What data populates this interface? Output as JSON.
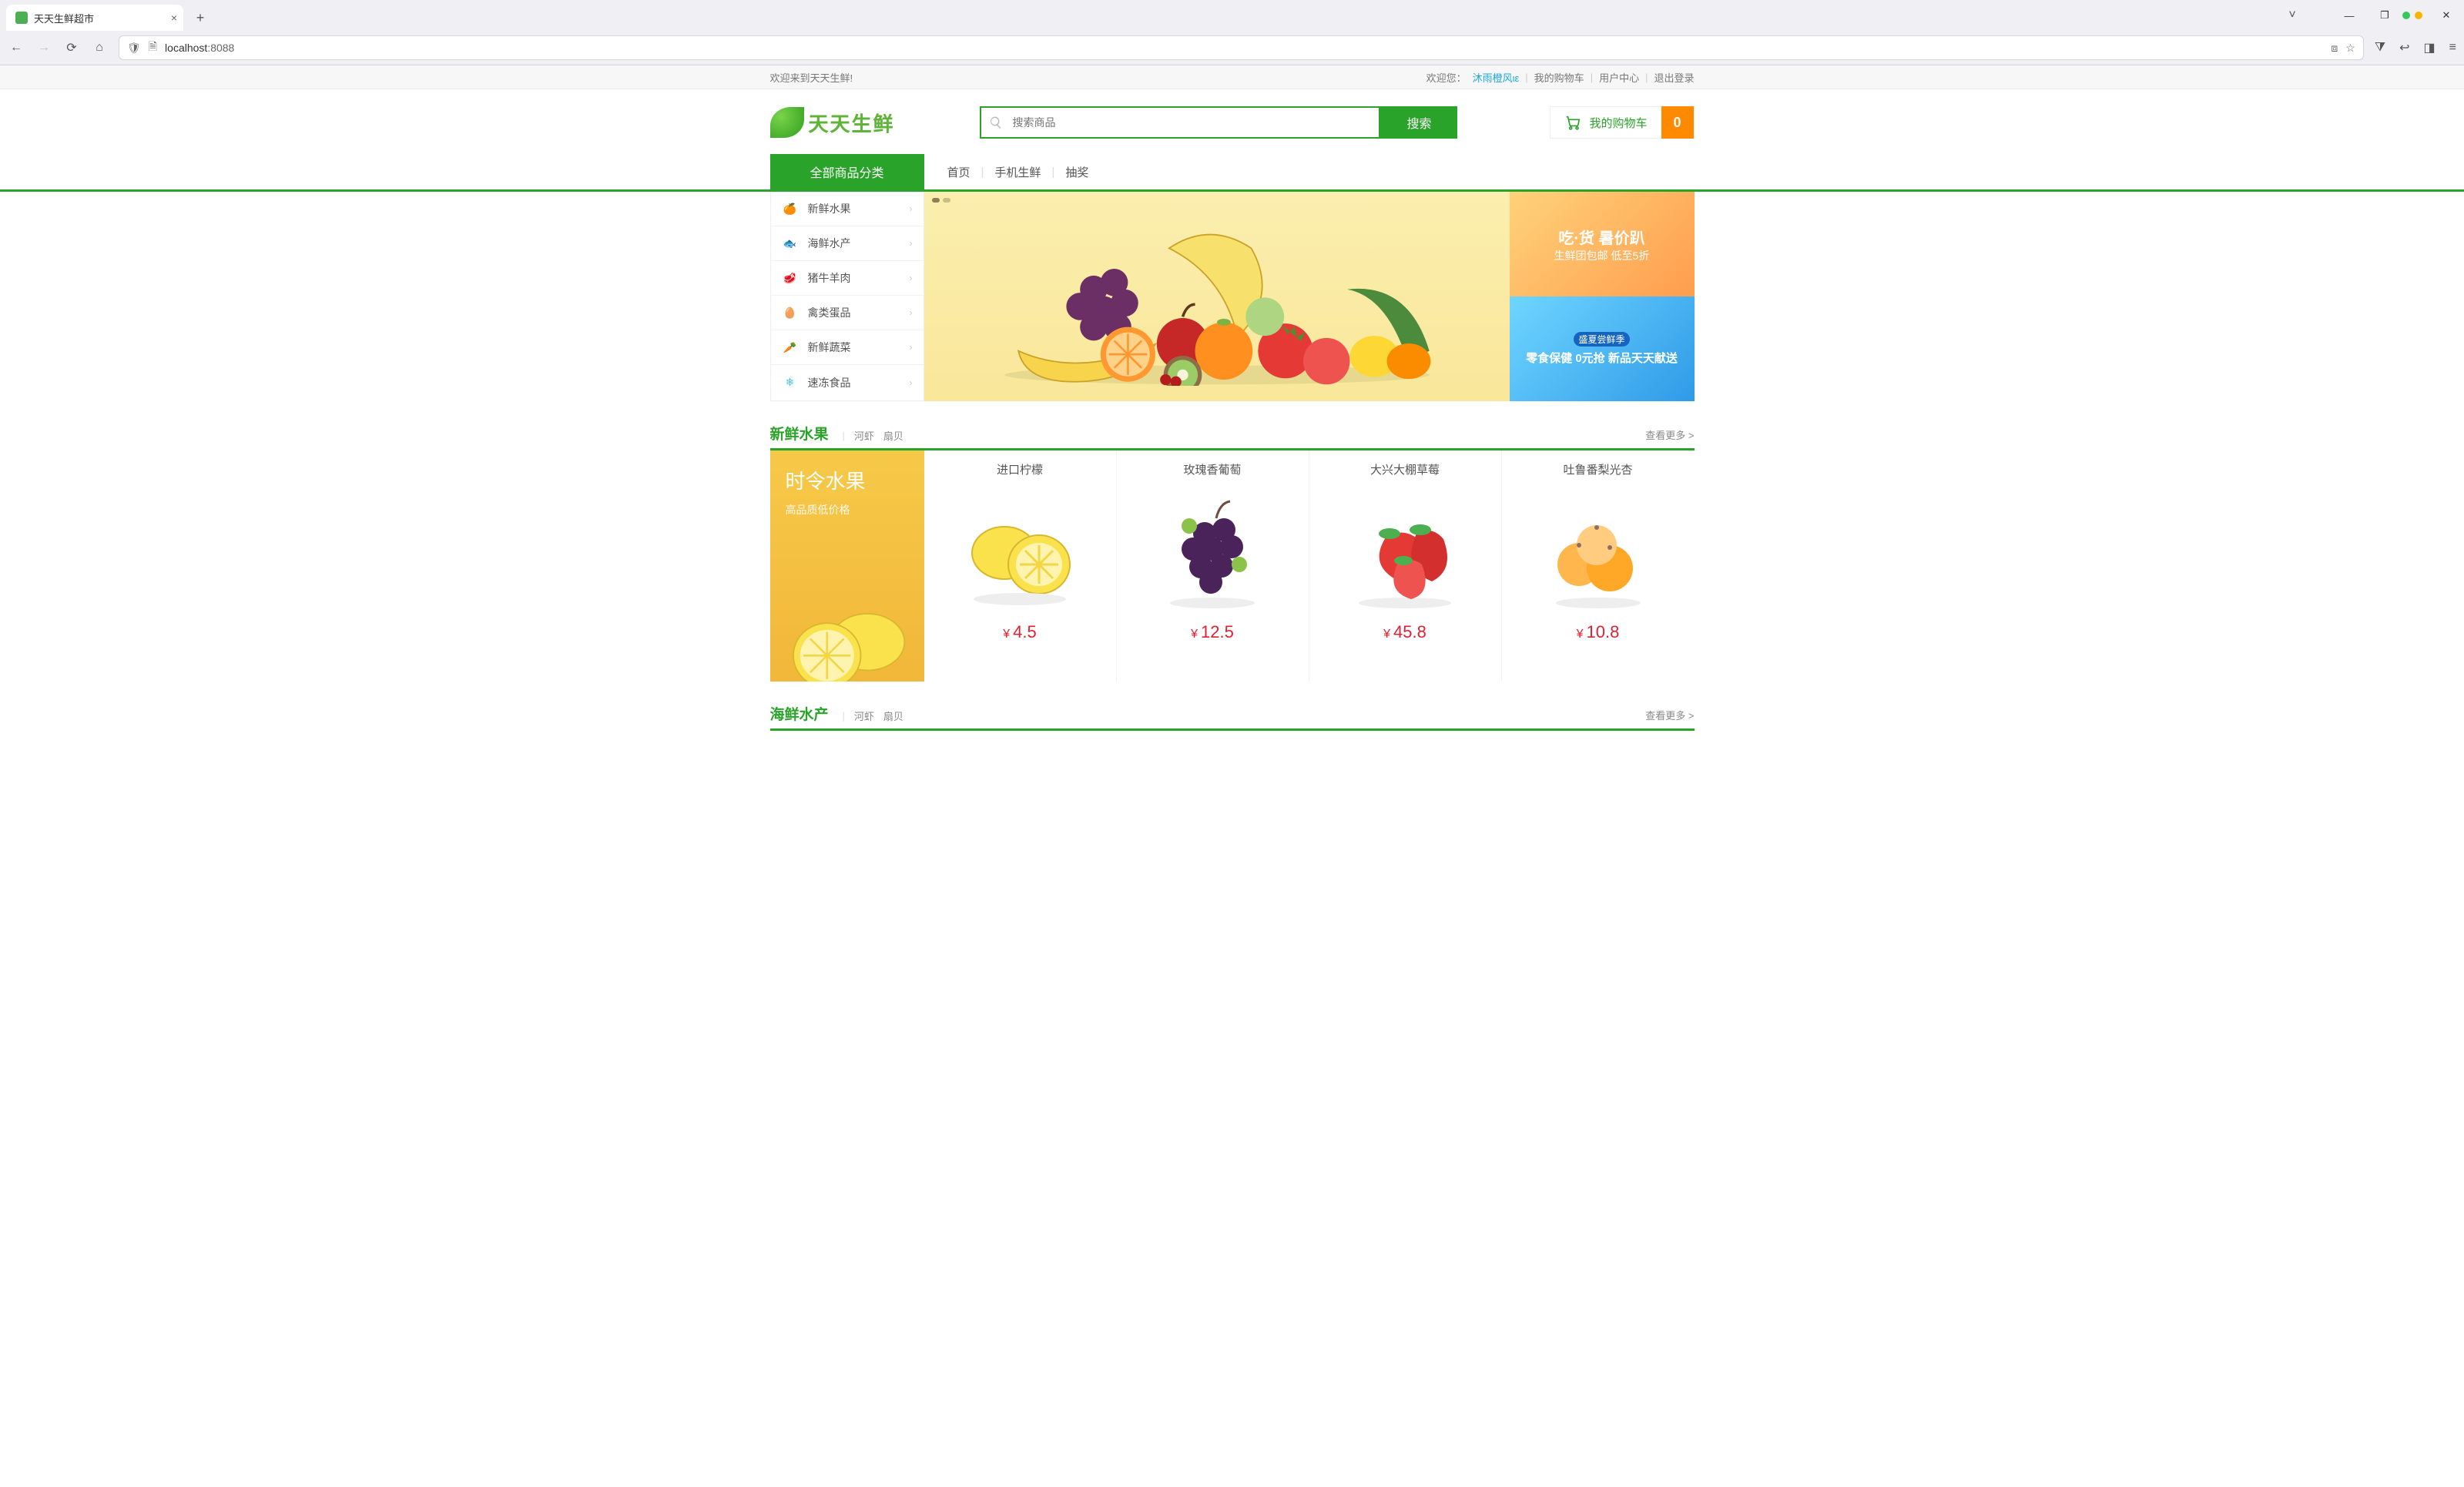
{
  "browser": {
    "tab_title": "天天生鲜超市",
    "url_host": "localhost",
    "url_port": ":8088",
    "new_tab": "+",
    "close": "×",
    "minimize": "—",
    "maximize": "❐",
    "close_win": "✕",
    "chevron": "˅"
  },
  "util": {
    "welcome": "欢迎来到天天生鲜!",
    "greet": "欢迎您：",
    "user": "沐雨橙风ιε",
    "links": [
      "我的购物车",
      "用户中心",
      "退出登录"
    ]
  },
  "header": {
    "logo_text": "天天生鲜",
    "search_placeholder": "搜索商品",
    "search_btn": "搜索",
    "cart_label": "我的购物车",
    "cart_count": "0"
  },
  "nav": {
    "all_cat": "全部商品分类",
    "items": [
      "首页",
      "手机生鲜",
      "抽奖"
    ]
  },
  "categories": [
    {
      "label": "新鲜水果",
      "color": "#f5a623"
    },
    {
      "label": "海鲜水产",
      "color": "#29b6d6"
    },
    {
      "label": "猪牛羊肉",
      "color": "#e57373"
    },
    {
      "label": "禽类蛋品",
      "color": "#ce93d8"
    },
    {
      "label": "新鲜蔬菜",
      "color": "#7cb342"
    },
    {
      "label": "速冻食品",
      "color": "#4fc3f7"
    }
  ],
  "promos": {
    "a_line1": "吃·货 暑价趴",
    "a_line2": "生鲜团包邮 低至5折",
    "b_line1": "盛夏尝鲜季",
    "b_line2": "零食保健 0元抢 新品天天献送"
  },
  "sections": [
    {
      "title": "新鲜水果",
      "sub": [
        "河虾",
        "扇贝"
      ],
      "more": "查看更多 >",
      "feature_title": "时令水果",
      "feature_sub": "高品质低价格",
      "products": [
        {
          "name": "进口柠檬",
          "price": "4.5",
          "kind": "lemon"
        },
        {
          "name": "玫瑰香葡萄",
          "price": "12.5",
          "kind": "grape"
        },
        {
          "name": "大兴大棚草莓",
          "price": "45.8",
          "kind": "strawberry"
        },
        {
          "name": "吐鲁番梨光杏",
          "price": "10.8",
          "kind": "apricot"
        }
      ]
    },
    {
      "title": "海鲜水产",
      "sub": [
        "河虾",
        "扇贝"
      ],
      "more": "查看更多 >"
    }
  ],
  "misc": {
    "currency": "¥",
    "sep": "|"
  }
}
